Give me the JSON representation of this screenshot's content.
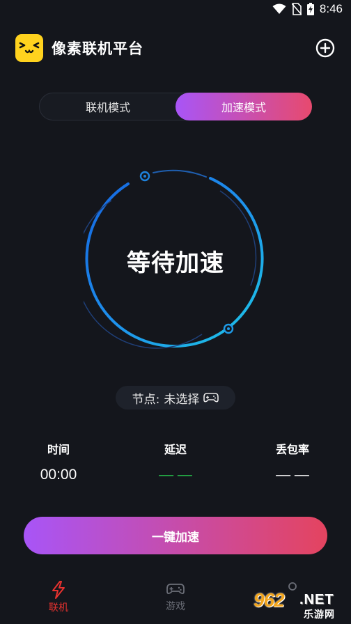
{
  "status_bar": {
    "time": "8:46"
  },
  "header": {
    "title": "像素联机平台"
  },
  "tabs": [
    {
      "label": "联机模式",
      "active": false
    },
    {
      "label": "加速模式",
      "active": true
    }
  ],
  "gauge": {
    "label": "等待加速"
  },
  "node": {
    "prefix": "节点:",
    "value": "未选择"
  },
  "stats": {
    "time": {
      "label": "时间",
      "value": "00:00"
    },
    "latency": {
      "label": "延迟",
      "value": "— —"
    },
    "loss": {
      "label": "丢包率",
      "value": "— —"
    }
  },
  "main_button": {
    "label": "一键加速"
  },
  "bottom_nav": [
    {
      "label": "联机",
      "active": true
    },
    {
      "label": "游戏",
      "active": false
    }
  ],
  "watermark": {
    "digits": "962",
    "net": ".NET",
    "sub": "乐游网"
  },
  "colors": {
    "background": "#14161c",
    "accent_start": "#a855f7",
    "accent_end": "#e4445f",
    "gauge_ring": "#1ea0e6",
    "active_nav": "#e8322f",
    "latency_green": "#27c24c"
  }
}
